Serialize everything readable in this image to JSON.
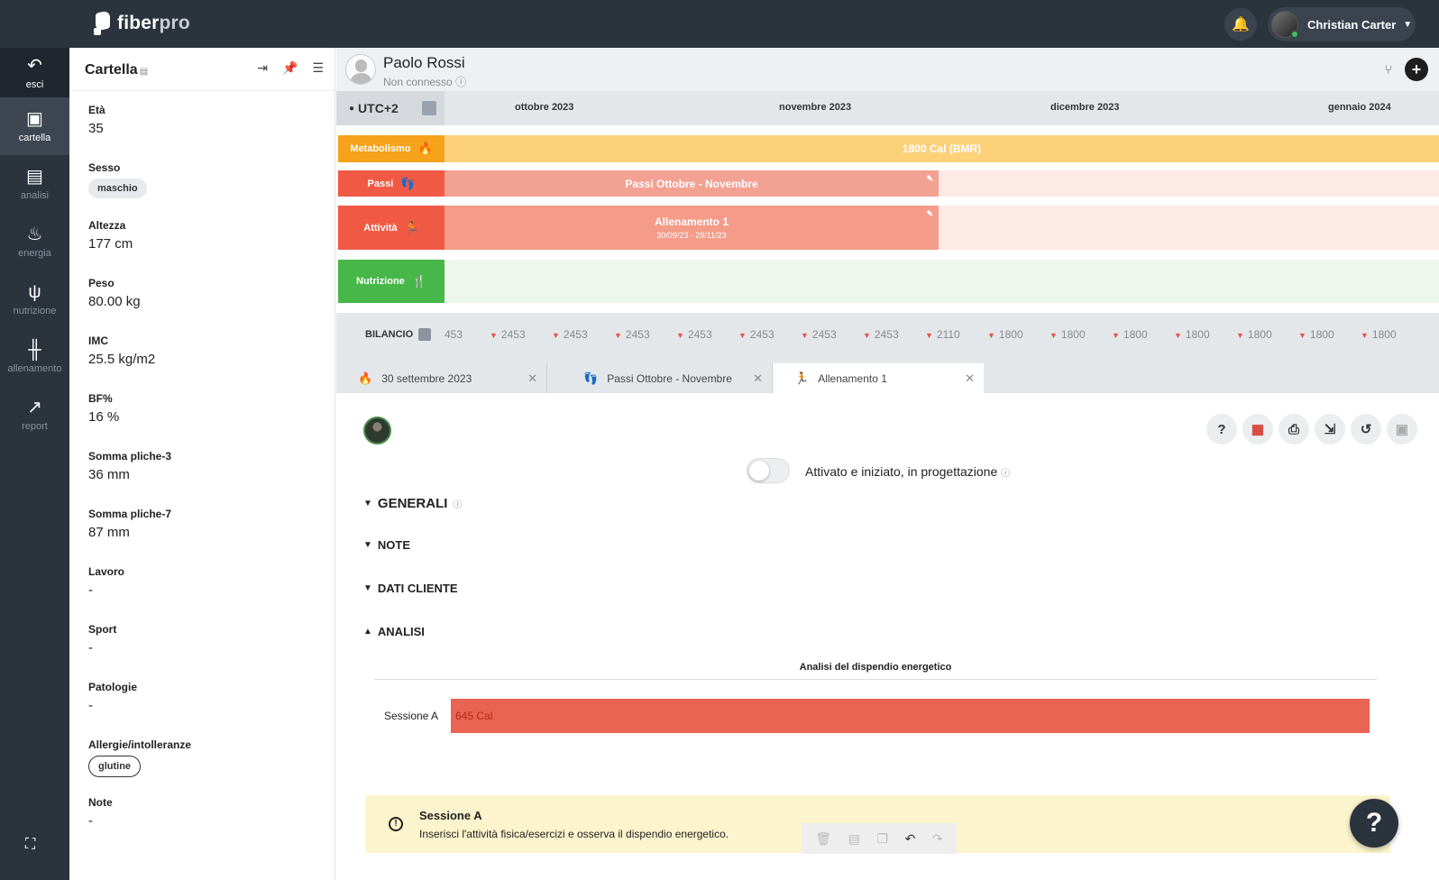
{
  "app": {
    "logo_main": "fiber",
    "logo_accent": "pro",
    "user_name": "Christian Carter"
  },
  "nav": {
    "exit": "esci",
    "items": [
      {
        "label": "cartella",
        "icon": "clipboard-icon",
        "glyph": "📋"
      },
      {
        "label": "analisi",
        "icon": "document-icon",
        "glyph": "▤"
      },
      {
        "label": "energia",
        "icon": "flame-icon",
        "glyph": "🔥"
      },
      {
        "label": "nutrizione",
        "icon": "fork-knife-icon",
        "glyph": "🍴"
      },
      {
        "label": "allenamento",
        "icon": "dumbbell-icon",
        "glyph": "⊪"
      },
      {
        "label": "report",
        "icon": "chart-icon",
        "glyph": "📈"
      }
    ]
  },
  "cartella": {
    "title": "Cartella",
    "fields": [
      {
        "key": "Età",
        "value": "35"
      },
      {
        "key": "Sesso",
        "chip": "maschio"
      },
      {
        "key": "Altezza",
        "value": "177 cm"
      },
      {
        "key": "Peso",
        "value": "80.00 kg"
      },
      {
        "key": "IMC",
        "value": "25.5 kg/m2"
      },
      {
        "key": "BF%",
        "value": "16 %"
      },
      {
        "key": "Somma pliche-3",
        "value": "36 mm"
      },
      {
        "key": "Somma pliche-7",
        "value": "87 mm"
      },
      {
        "key": "Lavoro",
        "value": "-"
      },
      {
        "key": "Sport",
        "value": "-"
      },
      {
        "key": "Patologie",
        "value": "-"
      },
      {
        "key": "Allergie/intolleranze",
        "chip": "glutine"
      },
      {
        "key": "Note",
        "value": "-"
      }
    ]
  },
  "patient": {
    "name": "Paolo Rossi",
    "status": "Non connesso"
  },
  "timeline": {
    "timezone": "UTC+2",
    "months": [
      "ottobre 2023",
      "novembre 2023",
      "dicembre 2023",
      "gennaio 2024"
    ],
    "rows": {
      "metabolismo": {
        "label": "Metabolismo",
        "bar_text": "1800 Cal (BMR)",
        "color": "#fdd17a",
        "label_color": "#f6a21a"
      },
      "passi": {
        "label": "Passi",
        "bar_text": "Passi Ottobre - Novembre",
        "color": "#f3a193",
        "label_color": "#f05a45"
      },
      "attivita": {
        "label": "Attività",
        "bar_text": "Allenamento 1",
        "bar_sub": "30/09/23 - 29/11/23",
        "color": "#f49c89",
        "label_color": "#f05a45"
      },
      "nutrizione": {
        "label": "Nutrizione",
        "color": "#eef7ec",
        "label_color": "#48b74a"
      }
    }
  },
  "bilancio": {
    "label": "BILANCIO",
    "values": [
      "453",
      "2453",
      "2453",
      "2453",
      "2453",
      "2453",
      "2453",
      "2453",
      "2110",
      "1800",
      "1800",
      "1800",
      "1800",
      "1800",
      "1800",
      "1800"
    ]
  },
  "tabs": [
    {
      "label": "30 settembre 2023",
      "icon": "flame-icon",
      "glyph": "🔥"
    },
    {
      "label": "Passi Ottobre - Novembre",
      "icon": "footsteps-icon",
      "glyph": "👣"
    },
    {
      "label": "Allenamento 1",
      "icon": "running-icon",
      "glyph": "🏃"
    }
  ],
  "detail": {
    "toggle_label": "Attivato e iniziato, in progettazione",
    "sections": [
      "GENERALI",
      "NOTE",
      "DATI CLIENTE",
      "ANALISI"
    ],
    "chart_title": "Analisi del dispendio energetico",
    "info_title": "Sessione A",
    "info_text": "Inserisci l'attività fisica/esercizi e osserva il dispendio energetico."
  },
  "chart_data": {
    "type": "bar",
    "title": "Analisi del dispendio energetico",
    "categories": [
      "Sessione A"
    ],
    "values": [
      645
    ],
    "value_labels": [
      "645 Cal"
    ],
    "unit": "Cal",
    "color": "#e96452",
    "orientation": "horizontal"
  }
}
